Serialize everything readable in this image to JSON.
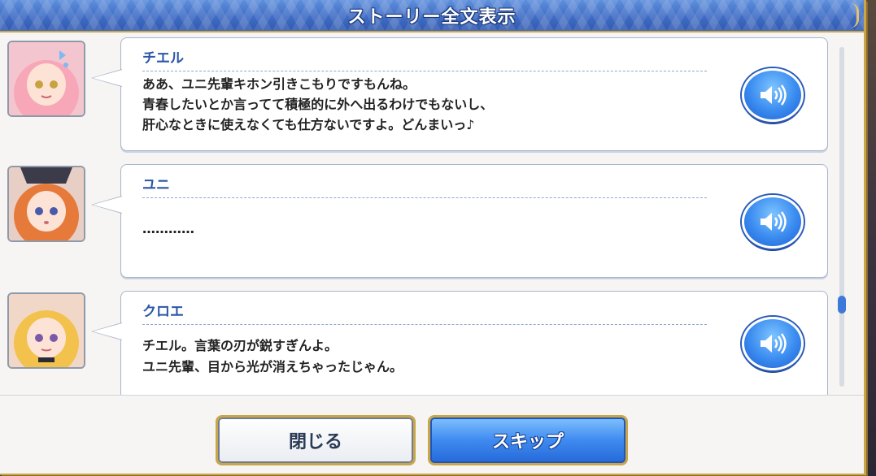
{
  "header": {
    "title": "ストーリー全文表示"
  },
  "entries": [
    {
      "speaker": "チエル",
      "lines": [
        "ああ、ユニ先輩キホン引きこもりですもんね。",
        "青春したいとか言ってて積極的に外へ出るわけでもないし、",
        "肝心なときに使えなくても仕方ないですよ。どんまいっ♪"
      ],
      "portrait_colors": {
        "hair": "#f7a7b8",
        "skin": "#fde3d6",
        "accent": "#7fb8f2"
      }
    },
    {
      "speaker": "ユニ",
      "lines": [
        "…………"
      ],
      "portrait_colors": {
        "hair": "#e67a3b",
        "skin": "#fde3d6",
        "accent": "#3b3b4a"
      }
    },
    {
      "speaker": "クロエ",
      "lines": [
        "チエル。言葉の刃が鋭すぎんよ。",
        "ユニ先輩、目から光が消えちゃったじゃん。"
      ],
      "portrait_colors": {
        "hair": "#f2c24d",
        "skin": "#fde3d6",
        "accent": "#2b2b36"
      }
    }
  ],
  "buttons": {
    "close": "閉じる",
    "skip": "スキップ"
  },
  "icons": {
    "voice": "speaker-sound-icon",
    "corner": "corner-ornament"
  },
  "colors": {
    "accent_blue": "#3f6cc4",
    "gold": "#c9a64a",
    "name_blue": "#2c56a8"
  }
}
